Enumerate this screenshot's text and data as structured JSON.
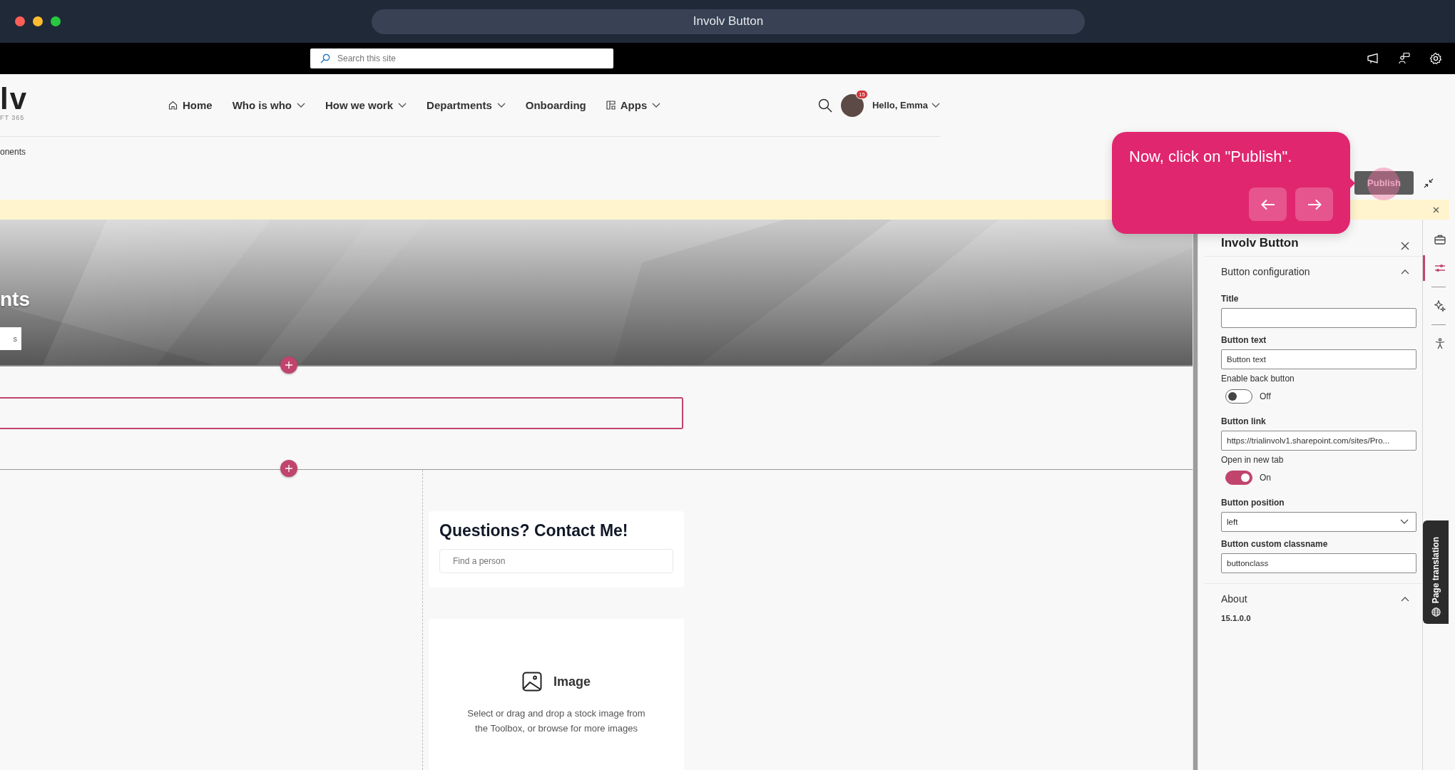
{
  "window": {
    "title": "Involv Button"
  },
  "top_bar": {
    "search": {
      "placeholder": "Search this site"
    }
  },
  "site": {
    "logo": "lv",
    "logo_sub": "FT 365"
  },
  "nav": [
    {
      "label": "Home",
      "has_menu": false
    },
    {
      "label": "Who is who",
      "has_menu": true
    },
    {
      "label": "How we work",
      "has_menu": true
    },
    {
      "label": "Departments",
      "has_menu": true
    },
    {
      "label": "Onboarding",
      "has_menu": false
    },
    {
      "label": "Apps",
      "has_menu": true
    }
  ],
  "user": {
    "greeting": "Hello, Emma",
    "badge": "15"
  },
  "breadcrumb": "onents",
  "publish_button": "Publish",
  "hero": {
    "title": "nts",
    "button": "s"
  },
  "contact_card": {
    "title": "Questions? Contact Me!",
    "search": {
      "placeholder": "Find a person"
    }
  },
  "image_card": {
    "title": "Image",
    "description": "Select or drag and drop a stock image from the Toolbox, or browse for more images"
  },
  "panel": {
    "title": "Involv Button",
    "sections": [
      {
        "title": "Button configuration",
        "expanded": true,
        "fields": [
          {
            "kind": "text",
            "label": "Title"
          },
          {
            "kind": "text",
            "label": "Button text",
            "value": "Button text"
          },
          {
            "kind": "toggle",
            "label": "Enable back button",
            "on": false,
            "state_label": "Off"
          },
          {
            "kind": "text",
            "label": "Button link",
            "value": "https://trialinvolv1.sharepoint.com/sites/Pro..."
          },
          {
            "kind": "toggle",
            "label": "Open in new tab",
            "on": true,
            "state_label": "On"
          },
          {
            "kind": "dropdown",
            "label": "Button position",
            "value": "left"
          },
          {
            "kind": "text",
            "label": "Button custom classname",
            "value": "buttonclass"
          }
        ]
      },
      {
        "title": "About",
        "expanded": true,
        "version": "15.1.0.0"
      }
    ]
  },
  "rail": [
    {
      "selected": false
    },
    {
      "selected": true
    },
    {
      "selected": false
    },
    {
      "selected": false
    }
  ],
  "page_translation": "Page translation",
  "tooltip": {
    "text": "Now, click on \"Publish\"."
  }
}
